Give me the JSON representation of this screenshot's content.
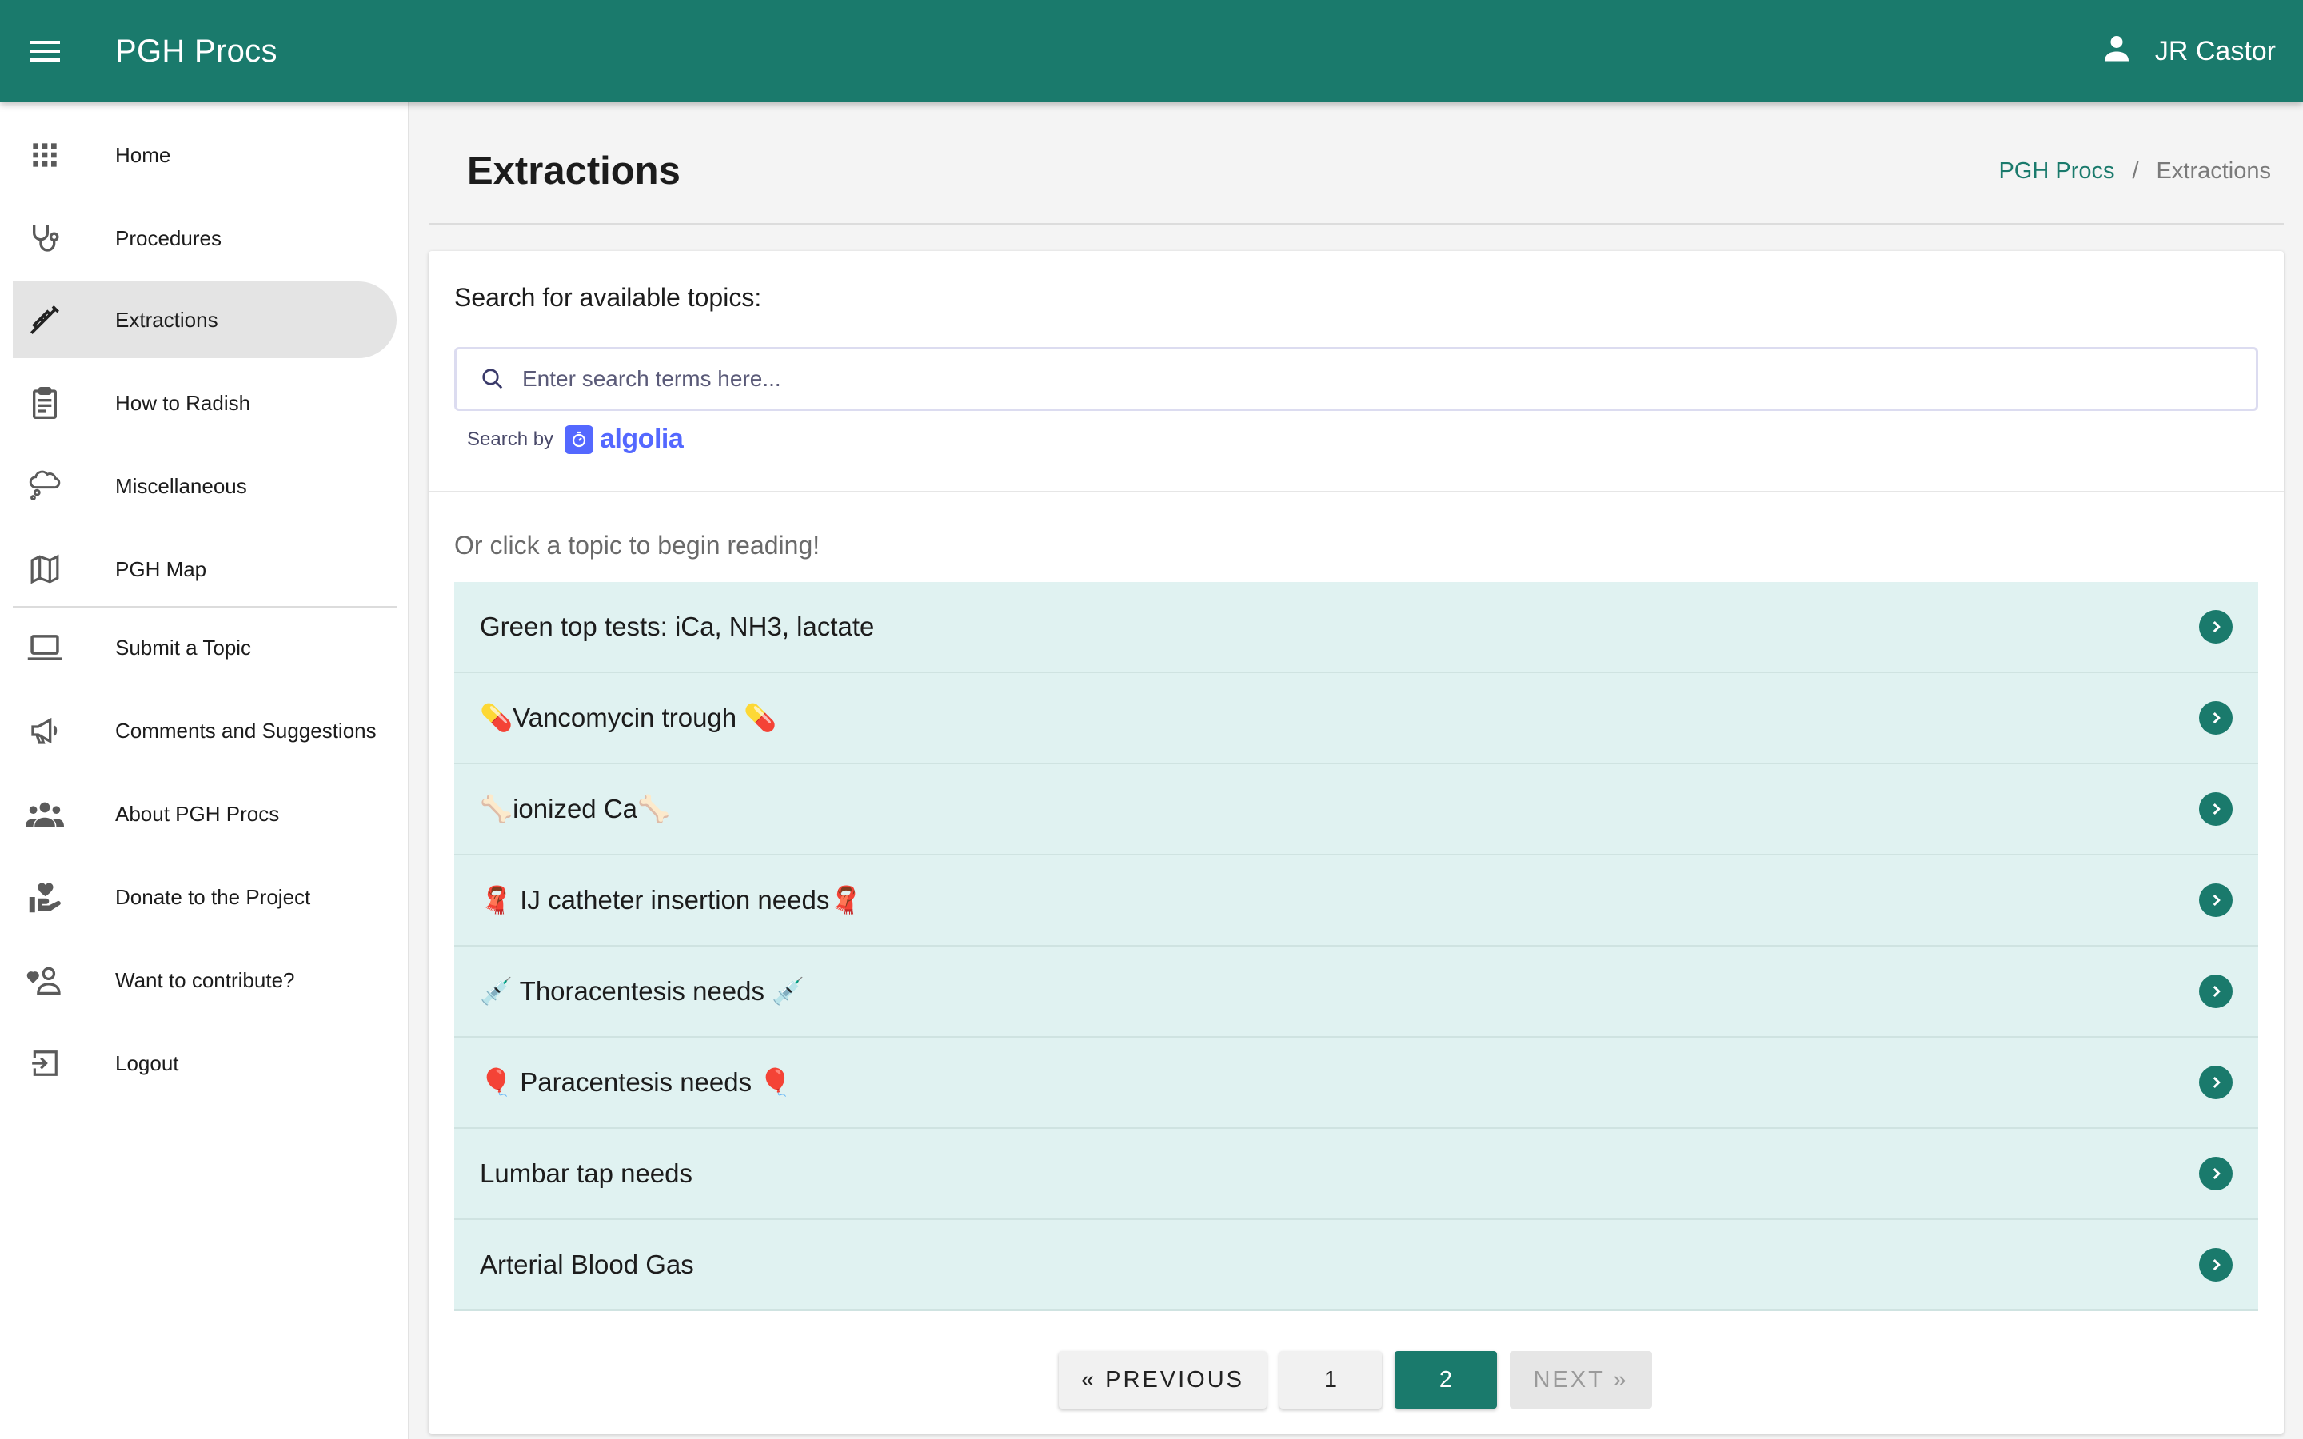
{
  "app": {
    "title": "PGH Procs"
  },
  "user": {
    "name": "JR Castor"
  },
  "sidebar": {
    "items": [
      {
        "label": "Home"
      },
      {
        "label": "Procedures"
      },
      {
        "label": "Extractions"
      },
      {
        "label": "How to Radish"
      },
      {
        "label": "Miscellaneous"
      },
      {
        "label": "PGH Map"
      },
      {
        "label": "Submit a Topic"
      },
      {
        "label": "Comments and Suggestions"
      },
      {
        "label": "About PGH Procs"
      },
      {
        "label": "Donate to the Project"
      },
      {
        "label": "Want to contribute?"
      },
      {
        "label": "Logout"
      }
    ],
    "active": "Extractions"
  },
  "page": {
    "title": "Extractions",
    "breadcrumb": {
      "root": "PGH Procs",
      "separator": "/",
      "current": "Extractions"
    }
  },
  "search": {
    "heading": "Search for available topics:",
    "placeholder": "Enter search terms here...",
    "powered_by": "Search by",
    "provider": "algolia"
  },
  "topics": {
    "hint": "Or click a topic to begin reading!",
    "items": [
      "Green top tests: iCa, NH3, lactate",
      "💊Vancomycin trough 💊",
      "🦴ionized Ca🦴",
      "🧣 IJ catheter insertion needs🧣",
      "💉 Thoracentesis needs 💉",
      "🎈 Paracentesis needs 🎈",
      "Lumbar tap needs",
      "Arterial Blood Gas"
    ]
  },
  "pagination": {
    "previous": "« PREVIOUS",
    "pages": [
      "1",
      "2"
    ],
    "current_page": "2",
    "next": "NEXT »"
  },
  "colors": {
    "primary": "#1a7a6c",
    "topic_bg": "#e0f2f1",
    "algolia": "#5468ff"
  }
}
